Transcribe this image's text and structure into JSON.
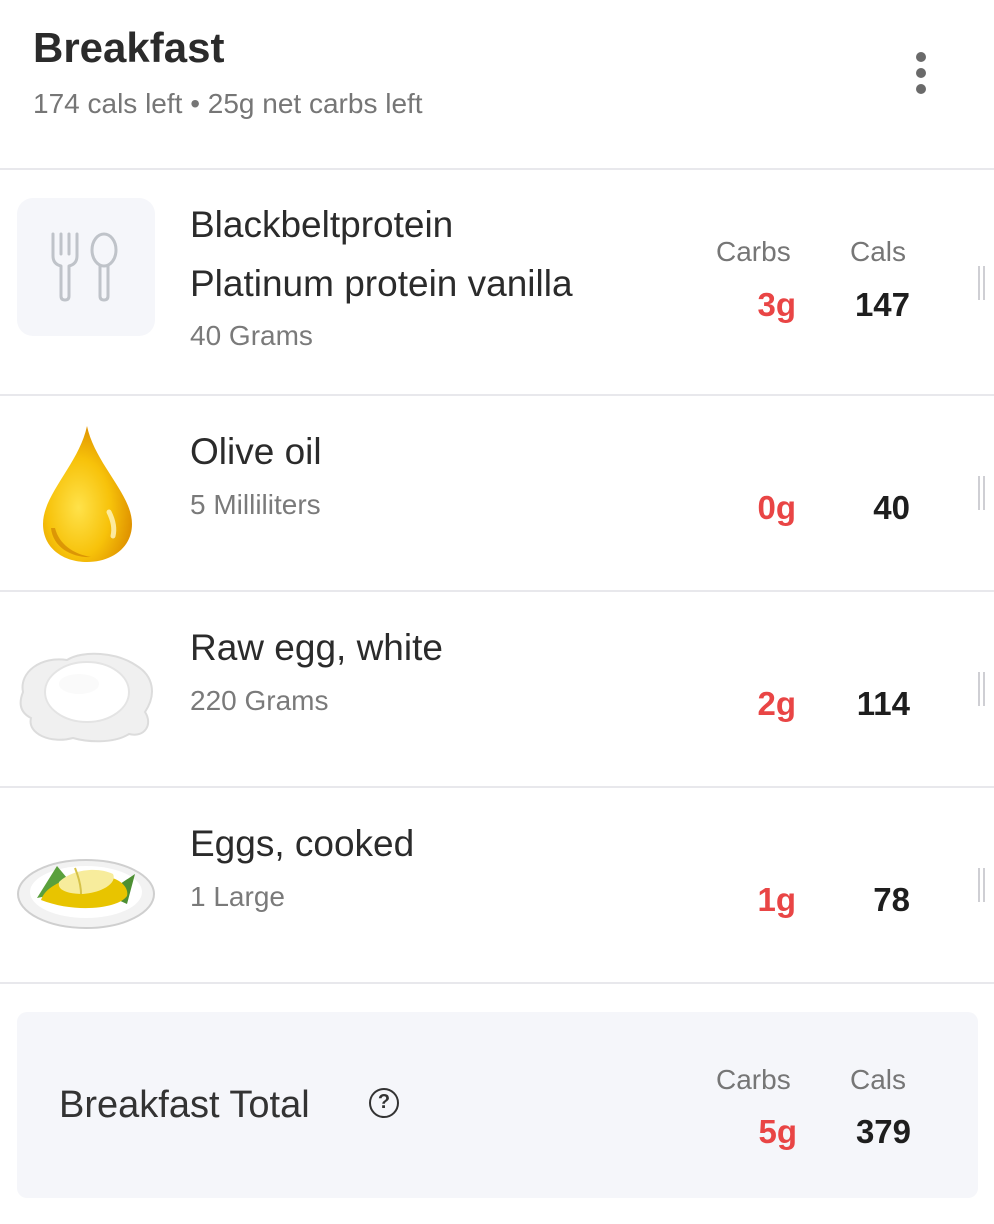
{
  "meal": {
    "title": "Breakfast",
    "subtitle": "174 cals left • 25g net carbs left"
  },
  "columns": {
    "carbs": "Carbs",
    "cals": "Cals"
  },
  "items": [
    {
      "name_line1": "Blackbeltprotein",
      "name_line2": "Platinum protein vanilla",
      "serving": "40 Grams",
      "carbs": "3g",
      "cals": "147",
      "icon": "fork-spoon-icon"
    },
    {
      "name": "Olive oil",
      "serving": "5 Milliliters",
      "carbs": "0g",
      "cals": "40",
      "icon": "oil-drop-icon"
    },
    {
      "name": "Raw egg, white",
      "serving": "220 Grams",
      "carbs": "2g",
      "cals": "114",
      "icon": "egg-white-icon"
    },
    {
      "name": "Eggs, cooked",
      "serving": "1 Large",
      "carbs": "1g",
      "cals": "78",
      "icon": "cooked-eggs-icon"
    }
  ],
  "total": {
    "label": "Breakfast Total",
    "carbs_label": "Carbs",
    "cals_label": "Cals",
    "carbs": "5g",
    "cals": "379",
    "help_icon": "help-icon"
  },
  "colors": {
    "carbs": "#e94545",
    "total_bg": "#f5f6fa",
    "divider": "#e8e8ec"
  }
}
